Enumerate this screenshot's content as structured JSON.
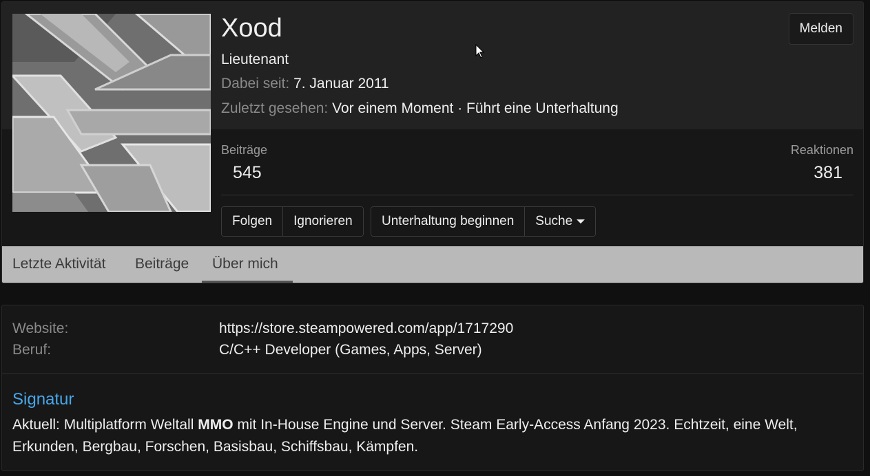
{
  "profile": {
    "name": "Xood",
    "rank": "Lieutenant",
    "joined_label": "Dabei seit:",
    "joined_value": "7. Januar 2011",
    "last_seen_label": "Zuletzt gesehen:",
    "last_seen_value": "Vor einem Moment · Führt eine Unterhaltung",
    "report_label": "Melden"
  },
  "stats": {
    "posts_label": "Beiträge",
    "posts_value": "545",
    "reactions_label": "Reaktionen",
    "reactions_value": "381"
  },
  "actions": {
    "follow": "Folgen",
    "ignore": "Ignorieren",
    "start_conversation": "Unterhaltung beginnen",
    "search": "Suche"
  },
  "tabs": [
    {
      "label": "Letzte Aktivität",
      "active": false
    },
    {
      "label": "Beiträge",
      "active": false
    },
    {
      "label": "Über mich",
      "active": true
    }
  ],
  "about": {
    "website_label": "Website:",
    "website_value": "https://store.steampowered.com/app/1717290",
    "job_label": "Beruf:",
    "job_value": "C/C++ Developer (Games, Apps, Server)"
  },
  "signature": {
    "title": "Signatur",
    "text_before": "Aktuell: Multiplatform Weltall ",
    "text_bold": "MMO",
    "text_after": " mit In-House Engine und Server. Steam Early-Access Anfang 2023. Echtzeit, eine Welt, Erkunden, Bergbau, Forschen, Basisbau, Schiffsbau, Kämpfen."
  },
  "colors": {
    "accent": "#47a7eb",
    "tab_bar": "#b9b9b9",
    "background": "#101010"
  }
}
